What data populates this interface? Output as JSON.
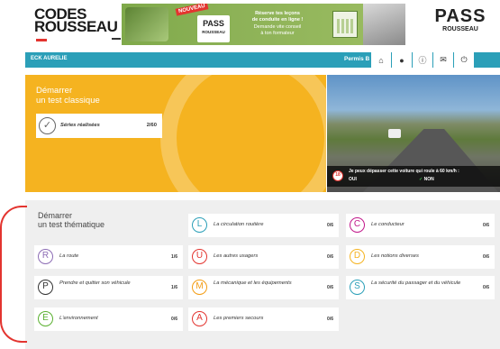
{
  "header": {
    "logo_line1": "CODES",
    "logo_line2": "ROUSSEAU",
    "banner": {
      "badge": "NOUVEAU",
      "pass_word": "PASS",
      "pass_sub": "ROUSSEAU",
      "text_line1": "Réserve tes leçons",
      "text_line2": "de conduite en ligne !",
      "text_line3": "Demande vite conseil",
      "text_line4": "à ton formateur"
    },
    "pass_logo_big": "PASS",
    "pass_logo_small": "ROUSSEAU"
  },
  "navbar": {
    "user": "ECK AURELIE",
    "permis": "Permis B",
    "icons": [
      "home-icon",
      "user-icon",
      "info-icon",
      "mail-icon",
      "power-icon"
    ],
    "icon_glyphs": [
      "⌂",
      "●",
      "ⓘ",
      "✉",
      "⏻"
    ]
  },
  "classic": {
    "title_line1": "Démarrer",
    "title_line2": "un test classique",
    "series_label": "Séries réalisées",
    "series_count": "2/60"
  },
  "question": {
    "number": "18",
    "text": "Je peux dépasser cette voiture qui roule à 60 km/h :",
    "option_a": "OUI",
    "option_b": "NON",
    "tick": "✓"
  },
  "thematic": {
    "title_line1": "Démarrer",
    "title_line2": "un test thématique",
    "themes": [
      {
        "letter": "L",
        "label": "La circulation routière",
        "score": "0/6",
        "color": "#2b9fb8"
      },
      {
        "letter": "C",
        "label": "Le conducteur",
        "score": "0/6",
        "color": "#c2188b"
      },
      {
        "letter": "R",
        "label": "La route",
        "score": "1/6",
        "color": "#8d6db5"
      },
      {
        "letter": "U",
        "label": "Les autres usagers",
        "score": "0/6",
        "color": "#e3342f"
      },
      {
        "letter": "D",
        "label": "Les notions diverses",
        "score": "0/6",
        "color": "#f5b320"
      },
      {
        "letter": "P",
        "label": "Prendre et quitter son véhicule",
        "score": "1/6",
        "color": "#333333"
      },
      {
        "letter": "M",
        "label": "La mécanique et les équipements",
        "score": "0/6",
        "color": "#f39c12"
      },
      {
        "letter": "S",
        "label": "La sécurité du passager et du véhicule",
        "score": "0/6",
        "color": "#2b9fb8"
      },
      {
        "letter": "E",
        "label": "L'environnement",
        "score": "0/6",
        "color": "#5ab030"
      },
      {
        "letter": "A",
        "label": "Les premiers secours",
        "score": "0/6",
        "color": "#e3342f"
      }
    ]
  }
}
